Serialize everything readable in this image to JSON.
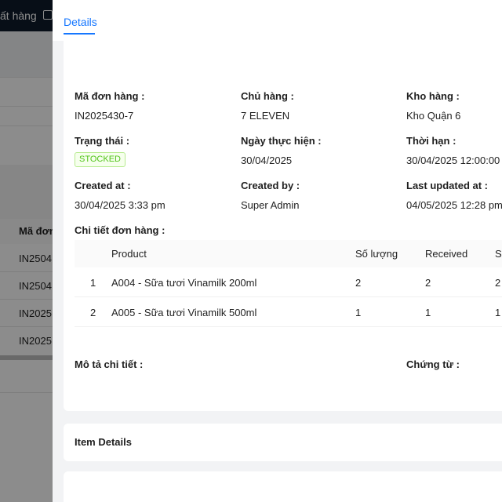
{
  "background": {
    "breadcrumb_text": "ất hàng",
    "table_header": "Mã đơn",
    "rows": [
      "IN2504",
      "IN2504",
      "IN2025",
      "IN2025"
    ]
  },
  "drawer": {
    "tab": "Details",
    "fields": {
      "order_code": {
        "label": "Mã đơn hàng :",
        "value": "IN2025430-7"
      },
      "owner": {
        "label": "Chủ hàng :",
        "value": "7 ELEVEN"
      },
      "warehouse": {
        "label": "Kho hàng :",
        "value": "Kho Quận 6"
      },
      "status": {
        "label": "Trạng thái :",
        "value": "STOCKED"
      },
      "exec_date": {
        "label": "Ngày thực hiện :",
        "value": "30/04/2025"
      },
      "deadline": {
        "label": "Thời hạn :",
        "value": "30/04/2025 12:00:00"
      },
      "created_at": {
        "label": "Created at :",
        "value": "30/04/2025 3:33 pm"
      },
      "created_by": {
        "label": "Created by :",
        "value": "Super Admin"
      },
      "updated_at": {
        "label": "Last updated at :",
        "value": "04/05/2025 12:28 pm"
      }
    },
    "detail_title": "Chi tiết đơn hàng :",
    "table": {
      "headers": [
        "Product",
        "Số lượng",
        "Received",
        "S"
      ],
      "rows": [
        {
          "index": "1",
          "product": "A004 - Sữa tươi Vinamilk 200ml",
          "qty": "2",
          "received": "2",
          "s": "2"
        },
        {
          "index": "2",
          "product": "A005 - Sữa tươi Vinamilk 500ml",
          "qty": "1",
          "received": "1",
          "s": "1"
        }
      ]
    },
    "description_label": "Mô tả chi tiết :",
    "documents_label": "Chứng từ :",
    "item_details_title": "Item Details"
  }
}
